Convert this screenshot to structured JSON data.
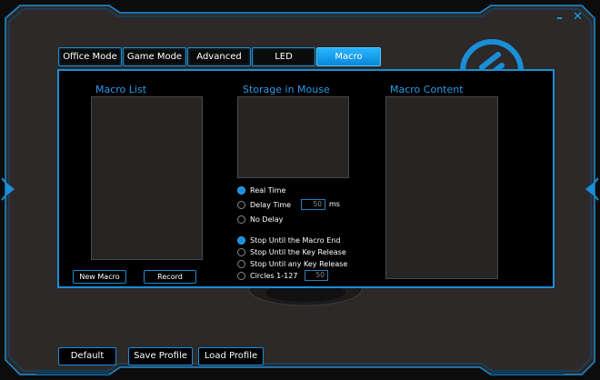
{
  "window": {
    "minimize_label": "–",
    "close_label": "✕"
  },
  "tabs": [
    {
      "label": "Office Mode",
      "active": false
    },
    {
      "label": "Game Mode",
      "active": false
    },
    {
      "label": "Advanced",
      "active": false
    },
    {
      "label": "LED",
      "active": false
    },
    {
      "label": "Macro",
      "active": true
    }
  ],
  "macro": {
    "macro_list_title": "Macro List",
    "storage_title": "Storage in Mouse",
    "content_title": "Macro Content",
    "delay_mode": {
      "options": [
        "Real Time",
        "Delay Time",
        "No Delay"
      ],
      "selected": "Real Time",
      "delay_value": "50",
      "delay_unit": "ms"
    },
    "repeat_mode": {
      "options": [
        "Stop Until the Macro End",
        "Stop Until the Key Release",
        "Stop Until any Key Release",
        "Circles 1-127"
      ],
      "selected": "Stop Until the Macro End",
      "circles_value": "50"
    },
    "new_macro_label": "New Macro",
    "record_label": "Record"
  },
  "footer": {
    "default_label": "Default",
    "save_profile_label": "Save Profile",
    "load_profile_label": "Load Profile"
  },
  "colors": {
    "accent": "#1a8ed8",
    "active_tab": "#1fa6f5",
    "background": "#2c2928",
    "title_text": "#2b9ae8"
  }
}
